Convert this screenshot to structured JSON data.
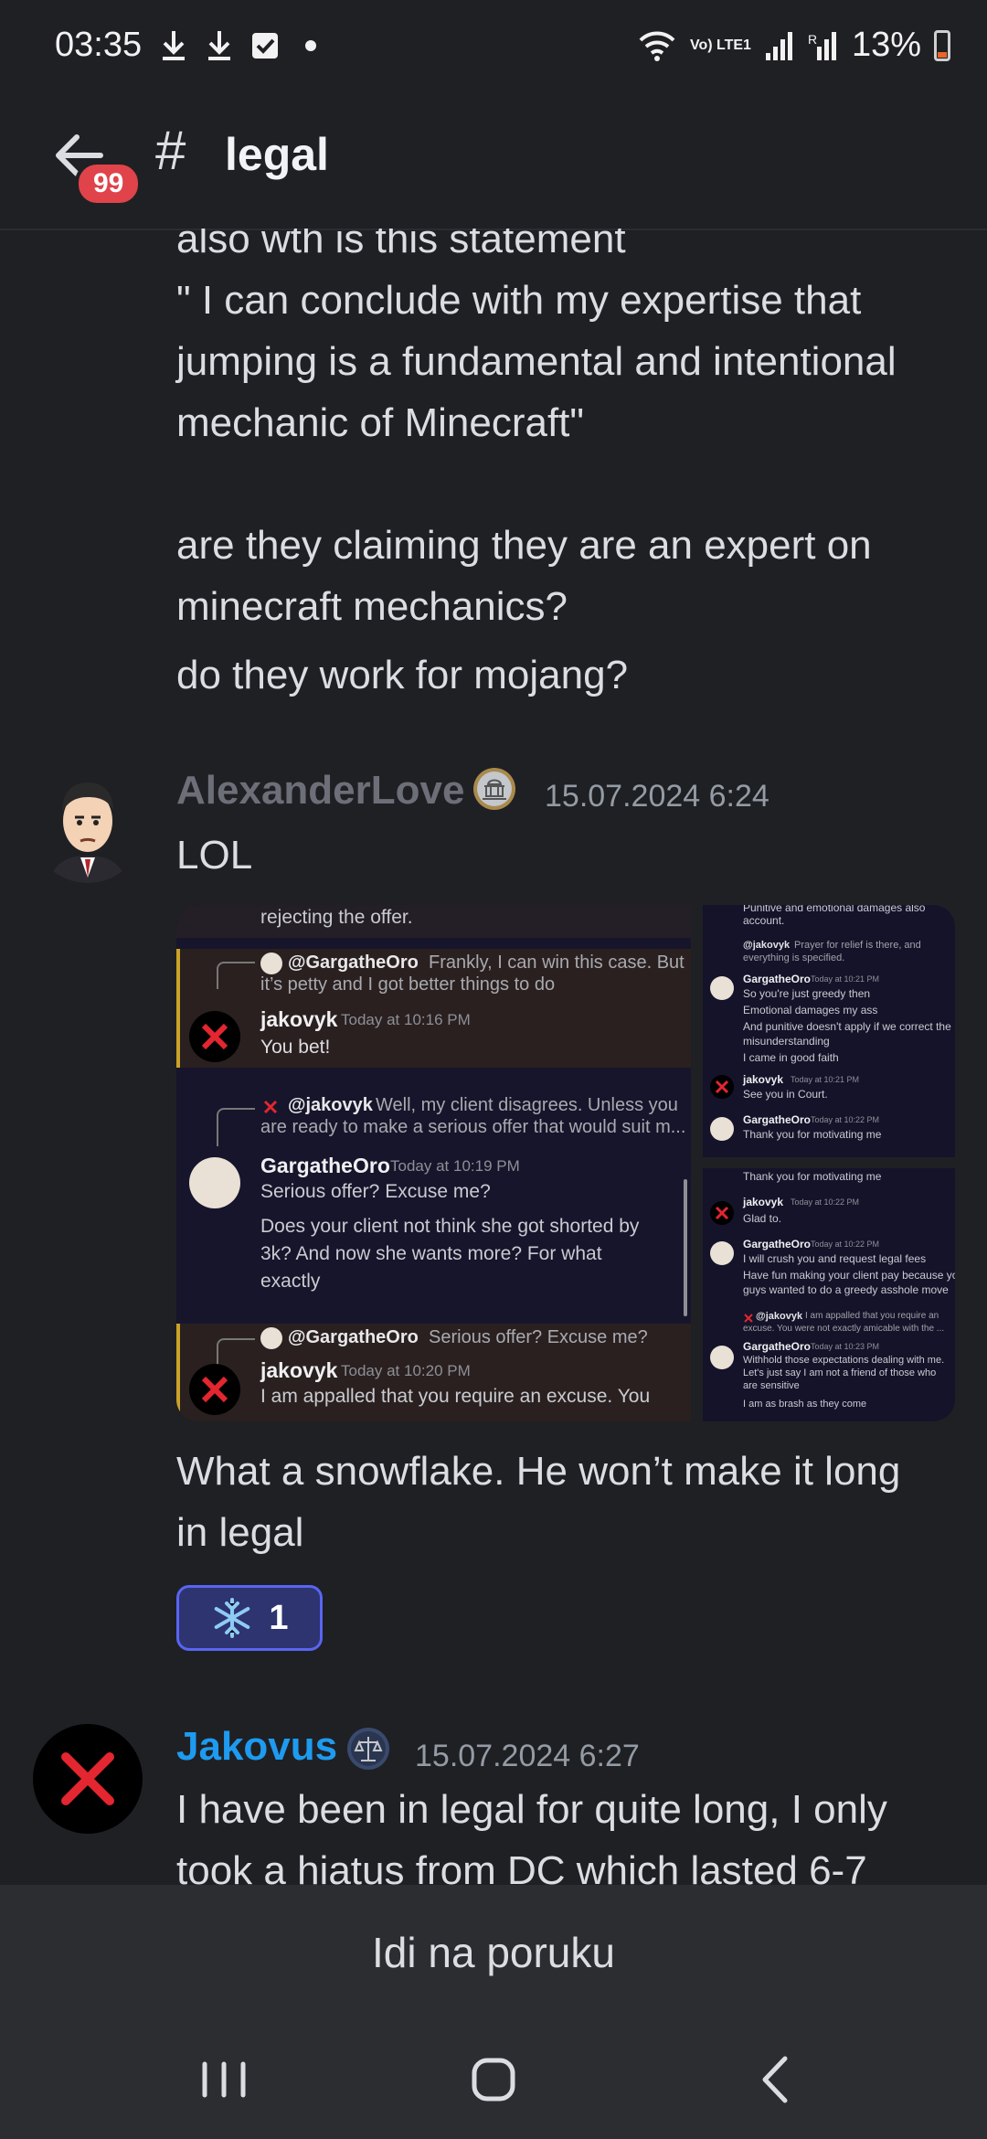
{
  "status_bar": {
    "time": "03:35",
    "battery": "13%",
    "network_label": "Vo) LTE1"
  },
  "header": {
    "channel_prefix": "#",
    "channel": "legal",
    "unread_badge": "99"
  },
  "messages": {
    "top_block": {
      "lines": [
        "also wth is this statement",
        "\" I can conclude with my expertise that",
        "jumping is a fundamental and intentional",
        "mechanic of Minecraft\"",
        "are they claiming they are an expert on",
        "minecraft mechanics?",
        "do they work for mojang?"
      ]
    },
    "alexander": {
      "author": "AlexanderLove",
      "timestamp": "15.07.2024 6:24",
      "text": "LOL",
      "followup": [
        "What a snowflake. He won’t make it long",
        "in legal"
      ],
      "reaction_count": "1"
    },
    "jakovus": {
      "author": "Jakovus",
      "timestamp": "15.07.2024 6:27",
      "lines": [
        "I have been in legal for quite long, I only",
        "took a hiatus from DC which lasted 6-7"
      ]
    }
  },
  "attachment_main": {
    "top_line": "rejecting the offer.",
    "r1_user": "@GargatheOro",
    "r1_text": "Frankly, I can win this case. But",
    "r1_text2": "it’s petty and I got better things to do",
    "m1_author": "jakovyk",
    "m1_time": "Today at 10:16 PM",
    "m1_text": "You bet!",
    "r2_user": "@jakovyk",
    "r2_text": "Well, my client disagrees. Unless you",
    "r2_text2": "are ready to make a serious offer that would suit m...",
    "m2_author": "GargatheOro",
    "m2_time": "Today at 10:19 PM",
    "m2_text1": "Serious offer? Excuse me?",
    "m2_text2": "Does your client not think she got shorted by",
    "m2_text3": "3k? And now she wants more? For what",
    "m2_text4": "exactly",
    "r3_user": "@GargatheOro",
    "r3_text": "Serious offer? Excuse me?",
    "m3_author": "jakovyk",
    "m3_time": "Today at 10:20 PM",
    "m3_text": "I am appalled that you require an excuse. You"
  },
  "attachment_side1": {
    "l1": "Punitive and emotional damages also",
    "l2": "account.",
    "r_user": "@jakovyk",
    "r_text": "Prayer for relief is there, and",
    "r_text2": "everything is specified.",
    "a1": "GargatheOro",
    "a1_time": "Today at 10:21 PM",
    "a1_l1": "So you're just greedy then",
    "a1_l2": "Emotional damages my ass",
    "a1_l3": "And punitive doesn't apply if we correct the",
    "a1_l4": "misunderstanding",
    "a1_l5": "I came in good faith",
    "a2": "jakovyk",
    "a2_time": "Today at 10:21 PM",
    "a2_l1": "See you in Court.",
    "a3": "GargatheOro",
    "a3_time": "Today at 10:22 PM",
    "a3_l1": "Thank you for motivating me"
  },
  "attachment_side2": {
    "top": "Thank you for motivating me",
    "a1": "jakovyk",
    "a1_time": "Today at 10:22 PM",
    "a1_l1": "Glad to.",
    "a2": "GargatheOro",
    "a2_time": "Today at 10:22 PM",
    "a2_l1": "I will crush you and request legal fees",
    "a2_l2": "Have fun making your client pay because you",
    "a2_l3": "guys wanted to do a greedy asshole move",
    "r_user": "@jakovyk",
    "r_text": "I am appalled that you require an",
    "r_text2": "excuse. You were not exactly amicable with the ...",
    "a3": "GargatheOro",
    "a3_time": "Today at 10:23 PM",
    "a3_l1": "Withhold those expectations dealing with me.",
    "a3_l2": "Let's just say I am not a friend of those who",
    "a3_l3": "are sensitive",
    "a3_l4": "I am as brash as they come"
  },
  "jump_bar": {
    "label": "Idi na poruku"
  },
  "colors": {
    "background": "#1f2024",
    "jakovus_name": "#1e9bf0",
    "alexander_name": "#6d6f78",
    "reaction_border": "#5865f2"
  },
  "icons": [
    "download-icon",
    "checkbox-icon",
    "wifi-icon",
    "signal-icon",
    "battery-icon",
    "back-arrow-icon",
    "snowflake-icon",
    "recent-apps-icon",
    "home-icon",
    "back-nav-icon"
  ]
}
